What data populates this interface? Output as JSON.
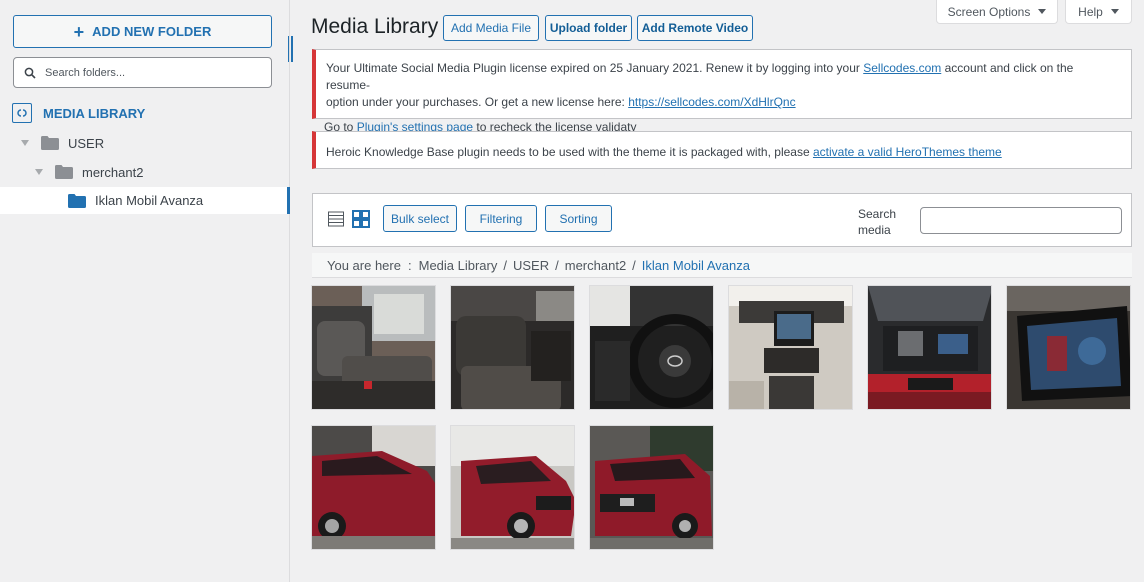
{
  "sidebar": {
    "add_folder_label": "ADD NEW FOLDER",
    "search_placeholder": "Search folders...",
    "root_label": "MEDIA LIBRARY",
    "tree": [
      {
        "label": "USER",
        "depth": 0,
        "expanded": true
      },
      {
        "label": "merchant2",
        "depth": 1,
        "expanded": true
      },
      {
        "label": "Iklan Mobil Avanza",
        "depth": 2,
        "selected": true
      }
    ]
  },
  "screen_options": {
    "screen_options_label": "Screen Options",
    "help_label": "Help"
  },
  "header": {
    "title": "Media Library",
    "add_media_label": "Add Media File",
    "upload_folder_label": "Upload folder",
    "add_remote_video_label": "Add Remote Video"
  },
  "notices": {
    "license": {
      "line1_pre": "Your Ultimate Social Media Plugin license expired on 25 January 2021. Renew it by logging into your ",
      "line1_link": "Sellcodes.com",
      "line1_post": " account and click on the resume-",
      "line2_pre": "option under your purchases. Or get a new license here: ",
      "line2_link": "https://sellcodes.com/XdHlrQnc",
      "line3_pre": "Go to ",
      "line3_link": "Plugin's settings page",
      "line3_post": " to recheck the license validaty"
    },
    "theme": {
      "text_pre": "Heroic Knowledge Base plugin needs to be used with the theme it is packaged with, please ",
      "link": "activate a valid HeroThemes theme"
    }
  },
  "toolbar": {
    "bulk_select_label": "Bulk select",
    "filtering_label": "Filtering",
    "sorting_label": "Sorting",
    "search_label": "Search media",
    "search_value": ""
  },
  "breadcrumb": {
    "prefix": "You are here",
    "colon": ":",
    "separator": "/",
    "items": [
      "Media Library",
      "USER",
      "merchant2",
      "Iklan Mobil Avanza"
    ]
  },
  "media": {
    "items": [
      {
        "subject": "car-interior-rear-seats"
      },
      {
        "subject": "car-interior-dark-seats"
      },
      {
        "subject": "car-steering-wheel"
      },
      {
        "subject": "car-dashboard-console"
      },
      {
        "subject": "car-engine-bay"
      },
      {
        "subject": "car-head-unit-screen"
      },
      {
        "subject": "red-car-side-view"
      },
      {
        "subject": "red-car-front-quarter"
      },
      {
        "subject": "red-car-front-view"
      }
    ]
  },
  "colors": {
    "accent": "#2271b1",
    "notice_error": "#d63638",
    "folder_gray": "#8c8f94",
    "folder_blue": "#2271b1",
    "car_red": "#8e1b2a"
  }
}
